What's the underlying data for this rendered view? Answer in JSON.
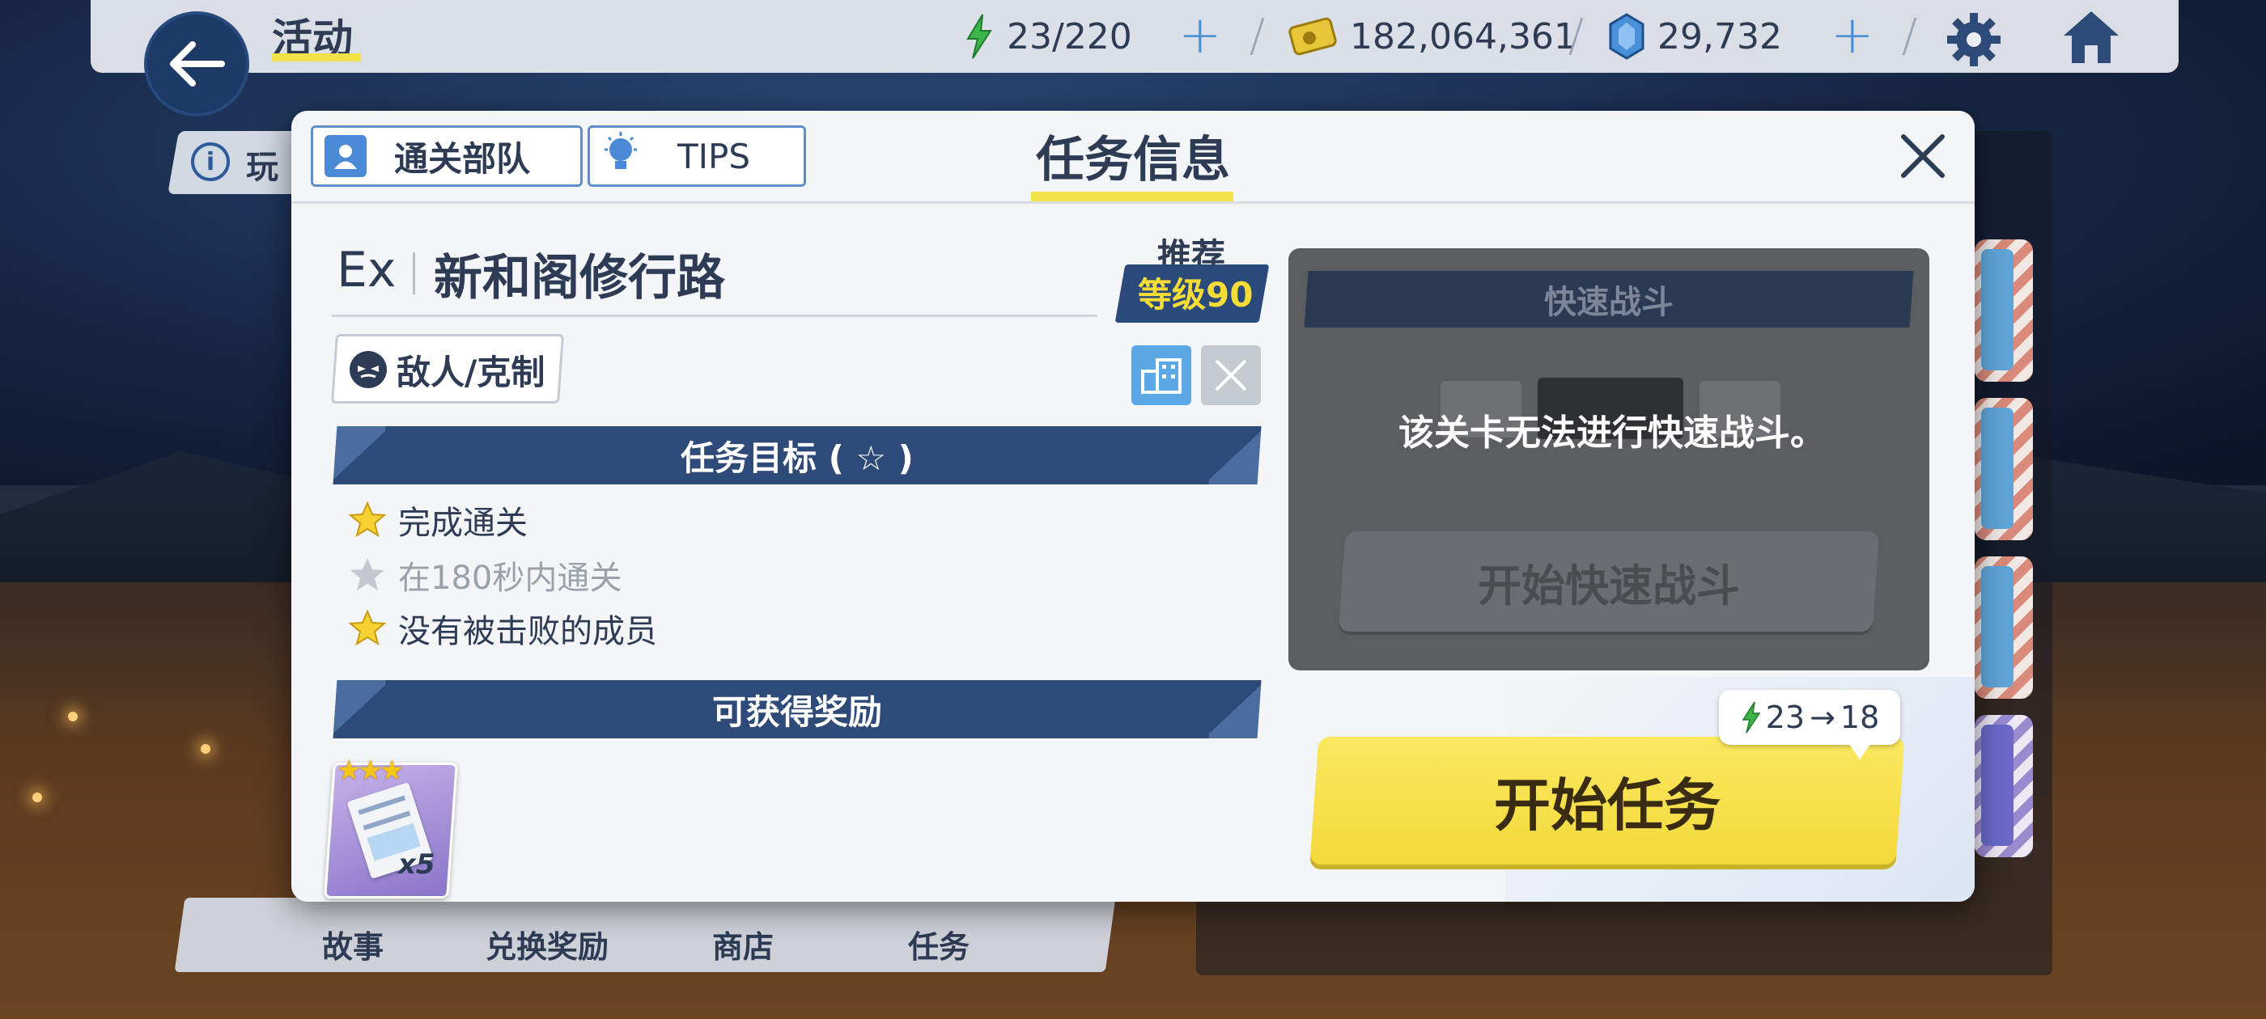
{
  "topbar": {
    "title": "活动",
    "stamina": "23/220",
    "credits": "182,064,361",
    "gems": "29,732"
  },
  "background": {
    "info_label": "玩",
    "nav": [
      "故事",
      "兑换奖励",
      "商店",
      "任务"
    ]
  },
  "modal": {
    "title": "任务信息",
    "tabs": [
      {
        "label": "通关部队",
        "icon": "party-icon"
      },
      {
        "label": "TIPS",
        "icon": "lightbulb-icon"
      }
    ],
    "stage_code": "Ex",
    "stage_name": "新和阁修行路",
    "recommend_label": "推荐",
    "recommend_level": "等级90",
    "enemy_button": "敌人/克制",
    "goals_header": "任务目标 ( ☆ )",
    "goals": [
      {
        "text": "完成通关",
        "achieved": true
      },
      {
        "text": "在180秒内通关",
        "achieved": false
      },
      {
        "text": "没有被击败的成员",
        "achieved": true
      }
    ],
    "rewards_header": "可获得奖励",
    "reward": {
      "stars": "★★★",
      "qty": "x5"
    },
    "quick_battle": {
      "header": "快速战斗",
      "message": "该关卡无法进行快速战斗。",
      "button": "开始快速战斗"
    },
    "cost": {
      "from": "23",
      "arrow": "→",
      "to": "18"
    },
    "start_button": "开始任务"
  },
  "colors": {
    "accent_yellow": "#f3d93a",
    "navy": "#2d4a78",
    "text": "#2d3b55"
  }
}
